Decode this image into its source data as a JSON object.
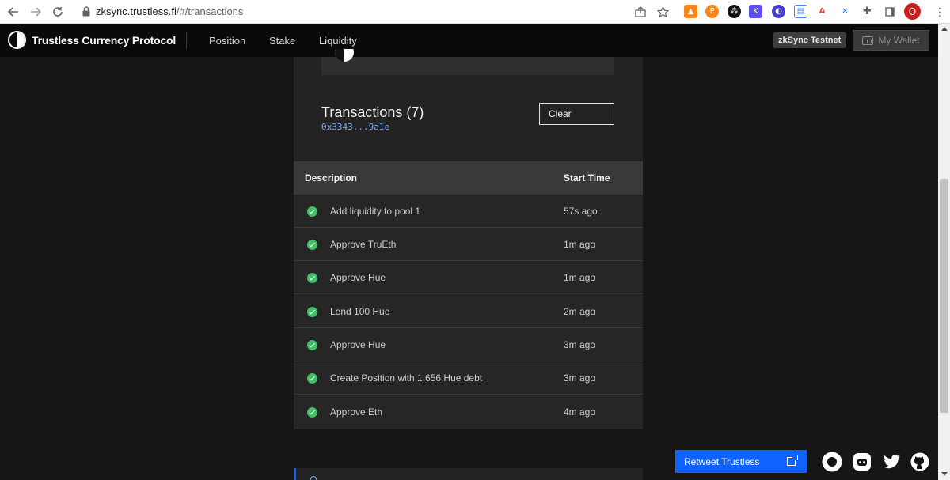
{
  "browser": {
    "url_host": "zksync.trustless.fi",
    "url_path": "/#/transactions",
    "profile_initial": "O",
    "extension_icons": [
      "metamask-icon",
      "p-icon",
      "k-icon",
      "circle-dots-icon",
      "window-icon",
      "font-icon",
      "x-icon",
      "puzzle-icon"
    ]
  },
  "header": {
    "brand": "Trustless Currency Protocol",
    "nav": [
      "Position",
      "Stake",
      "Liquidity"
    ],
    "network_badge": "zkSync Testnet",
    "wallet_button": "My Wallet"
  },
  "transactions": {
    "title": "Transactions (7)",
    "address": "0x3343...9a1e",
    "clear_button": "Clear",
    "columns": [
      "Description",
      "Start Time"
    ],
    "rows": [
      {
        "description": "Add liquidity to pool 1",
        "time": "57s ago",
        "status": "success"
      },
      {
        "description": "Approve TruEth",
        "time": "1m ago",
        "status": "success"
      },
      {
        "description": "Approve Hue",
        "time": "1m ago",
        "status": "success"
      },
      {
        "description": "Lend 100 Hue",
        "time": "2m ago",
        "status": "success"
      },
      {
        "description": "Approve Hue",
        "time": "3m ago",
        "status": "success"
      },
      {
        "description": "Create Position with 1,656 Hue debt",
        "time": "3m ago",
        "status": "success"
      },
      {
        "description": "Approve Eth",
        "time": "4m ago",
        "status": "success"
      }
    ]
  },
  "footer": {
    "retweet_button": "Retweet Trustless"
  },
  "colors": {
    "success": "#42be65",
    "accent": "#0f62fe",
    "address": "#78a9ff"
  }
}
